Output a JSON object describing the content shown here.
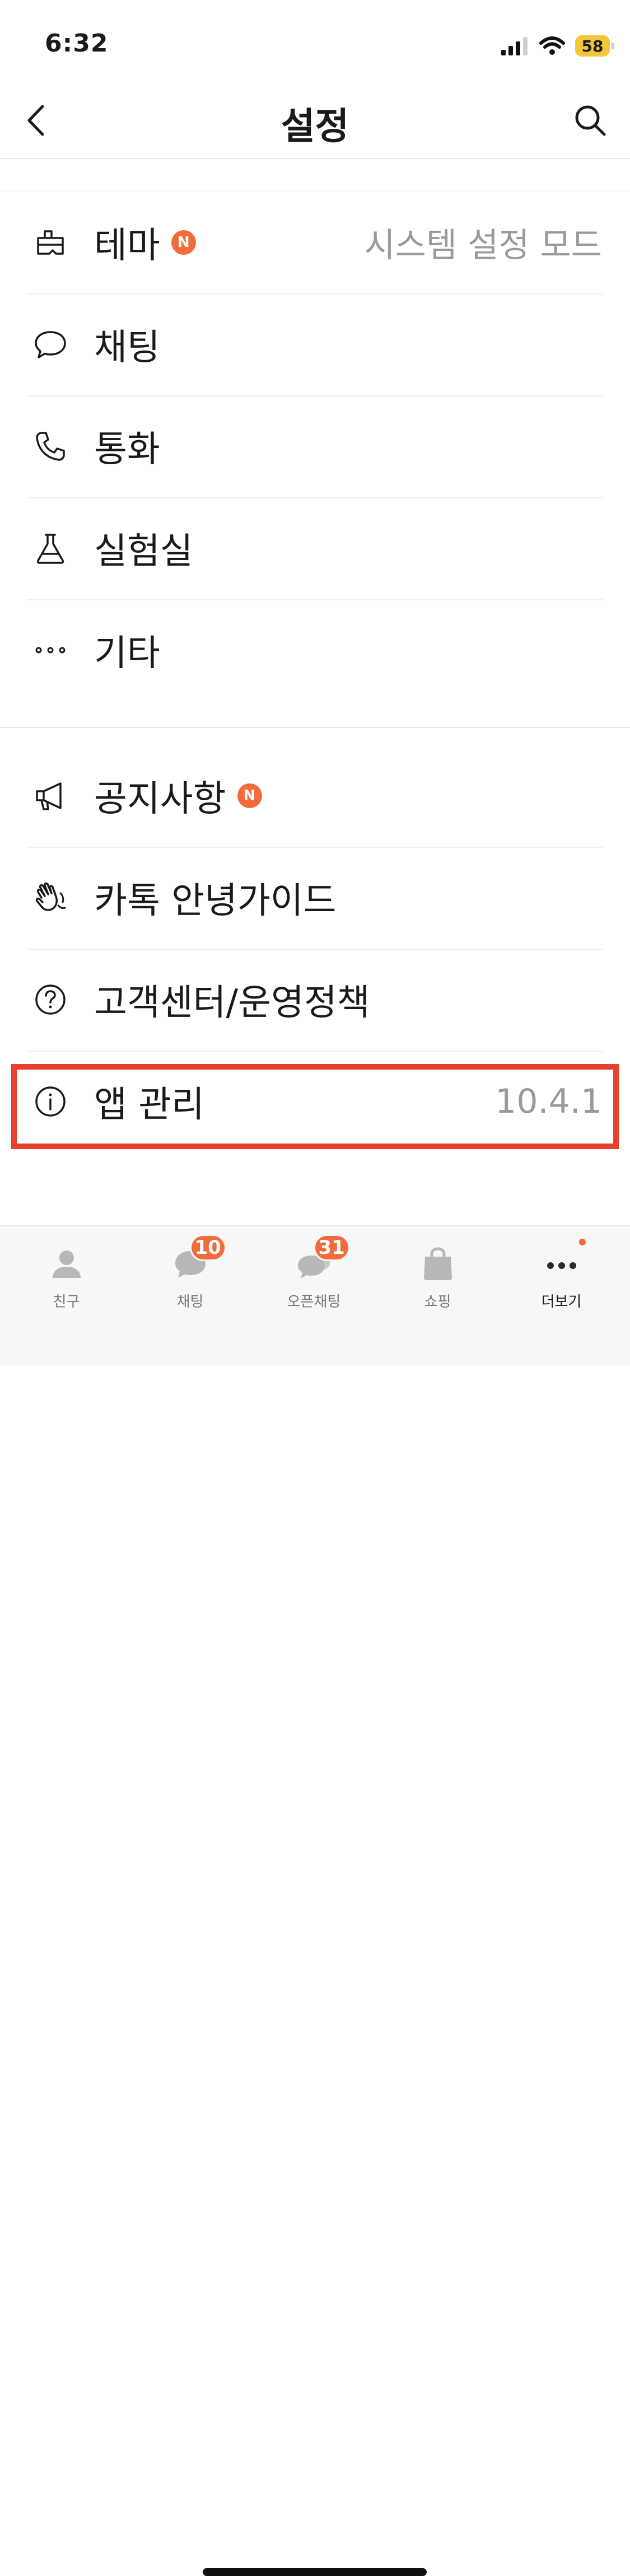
{
  "status_bar": {
    "time": "6:32",
    "battery": "58"
  },
  "header": {
    "title": "설정",
    "back_icon": "chevron-left-icon",
    "search_icon": "search-icon"
  },
  "settings_group_1": [
    {
      "label": "테마",
      "badge": "N",
      "value": "시스템 설정 모드",
      "icon": "theme-brush-icon"
    },
    {
      "label": "채팅",
      "icon": "chat-bubble-icon"
    },
    {
      "label": "통화",
      "icon": "phone-icon"
    },
    {
      "label": "실험실",
      "icon": "flask-icon"
    },
    {
      "label": "기타",
      "icon": "more-dots-icon"
    }
  ],
  "settings_group_2": [
    {
      "label": "공지사항",
      "badge": "N",
      "icon": "megaphone-icon"
    },
    {
      "label": "카톡 안녕가이드",
      "icon": "waving-hand-icon"
    },
    {
      "label": "고객센터/운영정책",
      "icon": "help-circle-icon"
    },
    {
      "label": "앱 관리",
      "value": "10.4.1",
      "icon": "info-circle-icon"
    }
  ],
  "tab_bar": {
    "tabs": [
      {
        "label": "친구",
        "icon": "friends-icon"
      },
      {
        "label": "채팅",
        "icon": "chat-tab-icon",
        "badge": "10"
      },
      {
        "label": "오픈채팅",
        "icon": "open-chat-icon",
        "badge": "31"
      },
      {
        "label": "쇼핑",
        "icon": "shopping-bag-icon"
      },
      {
        "label": "더보기",
        "icon": "more-tab-icon",
        "active": true
      }
    ]
  },
  "colors": {
    "accent_badge": "#f26b3a",
    "highlight_box": "#e8402c",
    "battery": "#f4c73a"
  }
}
